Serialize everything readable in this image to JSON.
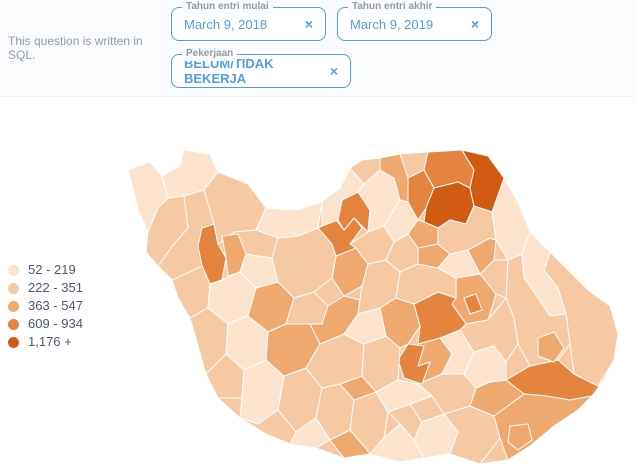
{
  "question": {
    "description": "This question is written in SQL."
  },
  "filters": [
    {
      "label": "Tahun entri mulai",
      "value": "March 9, 2018"
    },
    {
      "label": "Tahun entri akhir",
      "value": "March 9, 2019"
    },
    {
      "label": "Pekerjaan",
      "value": "BELUM/TIDAK BEKERJA"
    }
  ],
  "filter_clear_glyph": "×",
  "legend": [
    {
      "label": "52 - 219",
      "color": "#fbe3ce"
    },
    {
      "label": "222 - 351",
      "color": "#f6c9a3"
    },
    {
      "label": "363 - 547",
      "color": "#efa86d"
    },
    {
      "label": "609 - 934",
      "color": "#e5843e"
    },
    {
      "label": "1,176 +",
      "color": "#cf5c12"
    }
  ]
}
